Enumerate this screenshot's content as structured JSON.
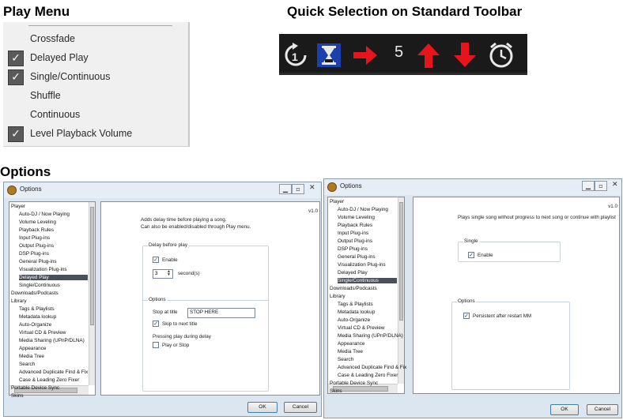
{
  "headings": {
    "play_menu": "Play Menu",
    "quick_selection": "Quick Selection on Standard Toolbar",
    "options": "Options"
  },
  "play_menu": {
    "items": [
      {
        "label": "Crossfade",
        "checked": false
      },
      {
        "label": "Delayed Play",
        "checked": true
      },
      {
        "label": "Single/Continuous",
        "checked": true
      },
      {
        "label": "Shuffle",
        "checked": false
      },
      {
        "label": "Continuous",
        "checked": false
      },
      {
        "label": "Level Playback Volume",
        "checked": true
      }
    ],
    "check_mark": "✓"
  },
  "toolbar": {
    "icons": [
      "repeat-one-icon",
      "hourglass-icon",
      "right-arrow-icon",
      "up-arrow-icon",
      "down-arrow-icon",
      "clock-icon"
    ],
    "number": "5",
    "colors": {
      "background": "#1a1a1a",
      "arrow": "#e8141c",
      "hourglass": "#1c3fae"
    }
  },
  "dialog_left": {
    "title": "Options",
    "version": "v1.0",
    "tree": [
      "Player",
      "Auto-DJ / Now Playing",
      "Volume Leveling",
      "Playback Rules",
      "Input Plug-ins",
      "Output Plug-ins",
      "DSP Plug-ins",
      "General Plug-ins",
      "Visualization Plug-ins",
      "Delayed Play",
      "Single/Continuous",
      "Downloads/Podcasts",
      "Library",
      "Tags & Playlists",
      "Metadata lookup",
      "Auto-Organize",
      "Virtual CD & Preview",
      "Media Sharing (UPnP/DLNA)",
      "Appearance",
      "Media Tree",
      "Search",
      "Advanced Duplicate Find & Fix",
      "Case & Leading Zero Fixer",
      "Portable Device Sync",
      "Skins"
    ],
    "selected": "Delayed Play",
    "description_1": "Adds delay time before playing a song.",
    "description_2": "Can also be enabled/disabled through Play menu.",
    "group1_label": "Delay before play",
    "enable_label": "Enable",
    "delay_value": "3",
    "seconds_label": "second(s)",
    "group2_label": "Options",
    "stop_at_title_label": "Stop at title",
    "stop_at_title_value": "STOP HERE",
    "skip_label": "Skip to next title",
    "pressing_label": "Pressing play during delay",
    "play_or_stop_label": "Play or Stop",
    "ok": "OK",
    "cancel": "Cancel"
  },
  "dialog_right": {
    "title": "Options",
    "version": "v1.0",
    "tree": [
      "Player",
      "Auto-DJ / Now Playing",
      "Volume Leveling",
      "Playback Rules",
      "Input Plug-ins",
      "Output Plug-ins",
      "DSP Plug-ins",
      "General Plug-ins",
      "Visualization Plug-ins",
      "Delayed Play",
      "Single/Continuous",
      "Downloads/Podcasts",
      "Library",
      "Tags & Playlists",
      "Metadata lookup",
      "Auto-Organize",
      "Virtual CD & Preview",
      "Media Sharing (UPnP/DLNA)",
      "Appearance",
      "Media Tree",
      "Search",
      "Advanced Duplicate Find & Fix",
      "Case & Leading Zero Fixer",
      "Portable Device Sync",
      "Skins"
    ],
    "selected": "Single/Continuous",
    "description": "Plays single song without progress to next song or continue with playlist",
    "group1_label": "Single",
    "enable_label": "Enable",
    "group2_label": "Options",
    "persistent_label": "Persistent after restart MM",
    "ok": "OK",
    "cancel": "Cancel"
  }
}
